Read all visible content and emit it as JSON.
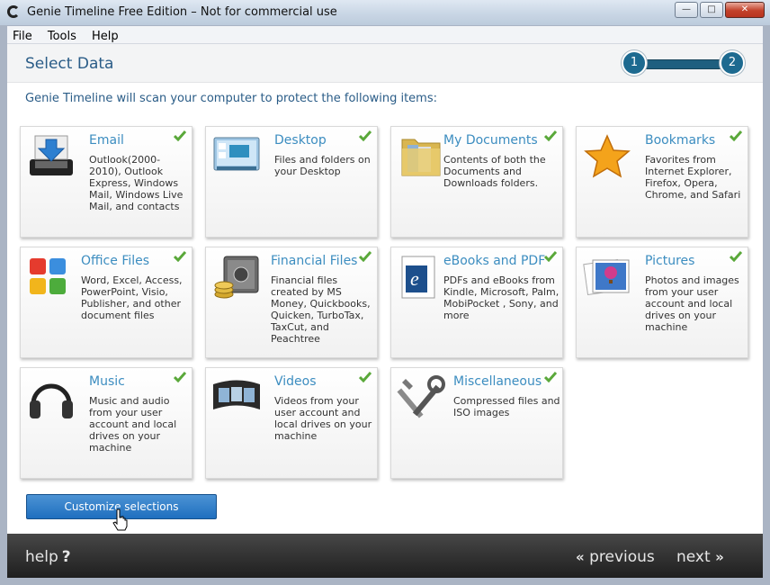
{
  "window": {
    "title": "Genie Timeline Free Edition – Not for commercial use",
    "min": "—",
    "max": "□",
    "close": "✕"
  },
  "menu": [
    "File",
    "Tools",
    "Help"
  ],
  "header": {
    "title": "Select Data",
    "steps": [
      "1",
      "2"
    ]
  },
  "intro": "Genie Timeline will scan your computer to protect the following items:",
  "tiles": [
    {
      "title": "Email",
      "desc": "Outlook(2000-2010), Outlook Express, Windows Mail, Windows Live Mail, and contacts",
      "icon": "inbox-download-icon",
      "checked": true
    },
    {
      "title": "Desktop",
      "desc": "Files and folders on your Desktop",
      "icon": "desktop-icon",
      "checked": true
    },
    {
      "title": "My Documents",
      "desc": "Contents of both the Documents and Downloads folders.",
      "icon": "documents-folder-icon",
      "checked": true
    },
    {
      "title": "Bookmarks",
      "desc": "Favorites from Internet Explorer, Firefox, Opera, Chrome, and Safari",
      "icon": "star-icon",
      "checked": true
    },
    {
      "title": "Office Files",
      "desc": "Word, Excel, Access, PowerPoint, Visio, Publisher, and other document files",
      "icon": "office-icon",
      "checked": true
    },
    {
      "title": "Financial Files",
      "desc": "Financial files created by MS Money, Quickbooks, Quicken, TurboTax, TaxCut, and Peachtree",
      "icon": "safe-coins-icon",
      "checked": true
    },
    {
      "title": "eBooks and PDF",
      "desc": "PDFs and eBooks from Kindle, Microsoft, Palm, MobiPocket , Sony, and more",
      "icon": "ebook-icon",
      "checked": true
    },
    {
      "title": "Pictures",
      "desc": "Photos and images from your user account and local drives on your machine",
      "icon": "photos-icon",
      "checked": true
    },
    {
      "title": "Music",
      "desc": "Music and audio from your user account and local drives on your machine",
      "icon": "headphones-icon",
      "checked": true
    },
    {
      "title": "Videos",
      "desc": "Videos from your user account and local drives on your machine",
      "icon": "film-icon",
      "checked": true
    },
    {
      "title": "Miscellaneous",
      "desc": "Compressed files and ISO images",
      "icon": "tools-icon",
      "checked": true
    }
  ],
  "customize_button": "Customize selections",
  "footer": {
    "help": "help",
    "help_mark": "?",
    "previous": "previous",
    "next": "next",
    "prev_chevron": "«",
    "next_chevron": "»"
  },
  "colors": {
    "accent": "#3c8dc0",
    "title": "#2a5c87",
    "button": "#1f6fbf",
    "check": "#5aa83a",
    "footer": "#2a2a2a"
  }
}
